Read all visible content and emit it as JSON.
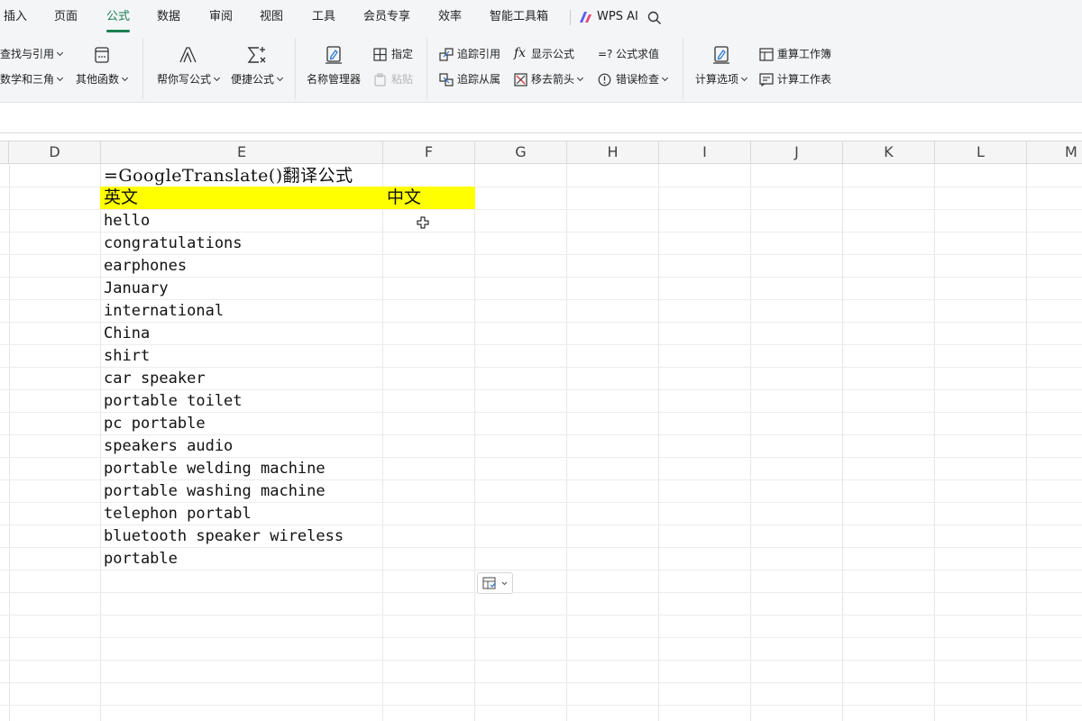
{
  "menu": {
    "items": [
      "插入",
      "页面",
      "公式",
      "数据",
      "审阅",
      "视图",
      "工具",
      "会员专享",
      "效率",
      "智能工具箱"
    ],
    "active": "公式",
    "wps_ai": "WPS AI"
  },
  "ribbon": {
    "lookup_ref": "查找与引用",
    "math_trig": "数学和三角",
    "other_functions": "其他函数",
    "formula_helper": "帮你写公式",
    "quick_formula": "便捷公式",
    "name_manager": "名称管理器",
    "assign": "指定",
    "paste": "粘贴",
    "trace_precedents": "追踪引用",
    "trace_dependents": "追踪从属",
    "show_formulas": "显示公式",
    "remove_arrows": "移去箭头",
    "evaluate_formula": "公式求值",
    "error_check": "错误检查",
    "calc_options": "计算选项",
    "recalc_workbook": "重算工作簿",
    "calc_sheet": "计算工作表"
  },
  "columns": [
    "D",
    "E",
    "F",
    "G",
    "H",
    "I",
    "J",
    "K",
    "L",
    "M"
  ],
  "sheet": {
    "title": "=GoogleTranslate()翻译公式",
    "header_en": "英文",
    "header_zh": "中文",
    "words": [
      "hello",
      "congratulations",
      "earphones",
      "January",
      "international",
      "China",
      "shirt",
      "car speaker",
      "portable toilet",
      "pc portable",
      "speakers audio",
      "portable welding machine",
      "portable washing machine",
      "telephon portabl",
      "bluetooth speaker wireless",
      "portable"
    ]
  },
  "colors": {
    "accent": "#1a7f54",
    "highlight": "#ffff00"
  }
}
